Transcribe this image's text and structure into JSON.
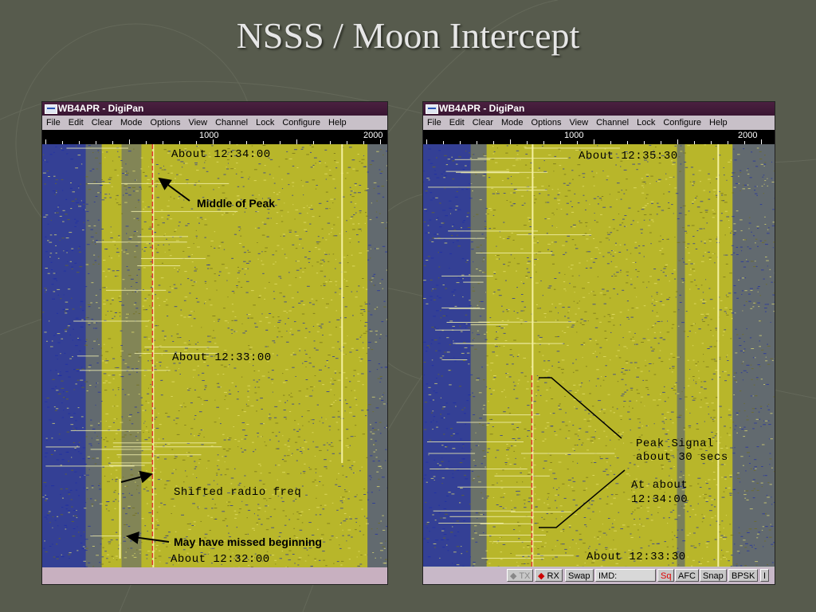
{
  "slide": {
    "title": "NSSS / Moon Intercept"
  },
  "windows": [
    {
      "title": "WB4APR - DigiPan",
      "menu": [
        "File",
        "Edit",
        "Clear",
        "Mode",
        "Options",
        "View",
        "Channel",
        "Lock",
        "Configure",
        "Help"
      ],
      "ruler": [
        "1000",
        "2000"
      ],
      "annotations": {
        "t1": "About 12:34:00",
        "peak": "Middle of Peak",
        "t2": "About 12:33:00",
        "shifted": "Shifted radio freq",
        "missed": "May have missed beginning",
        "t3": "About 12:32:00"
      }
    },
    {
      "title": "WB4APR - DigiPan",
      "menu": [
        "File",
        "Edit",
        "Clear",
        "Mode",
        "Options",
        "View",
        "Channel",
        "Lock",
        "Configure",
        "Help"
      ],
      "ruler": [
        "1000",
        "2000"
      ],
      "annotations": {
        "t1": "About 12:35:30",
        "peak1": "Peak Signal",
        "peak2": "about 30 secs",
        "at1": "At about",
        "at2": "12:34:00",
        "t3": "About 12:33:30"
      },
      "status": {
        "tx": "TX",
        "rx": "RX",
        "swap": "Swap",
        "imd": "IMD:",
        "sq": "Sq",
        "afc": "AFC",
        "snap": "Snap",
        "bpsk": "BPSK",
        "extra": "I"
      }
    }
  ],
  "colors": {
    "waterfall_bg": "#b8b62a",
    "waterfall_noise": "#1c2ca8",
    "marker": "#e0362a",
    "carrier": "#f4f0a0"
  }
}
